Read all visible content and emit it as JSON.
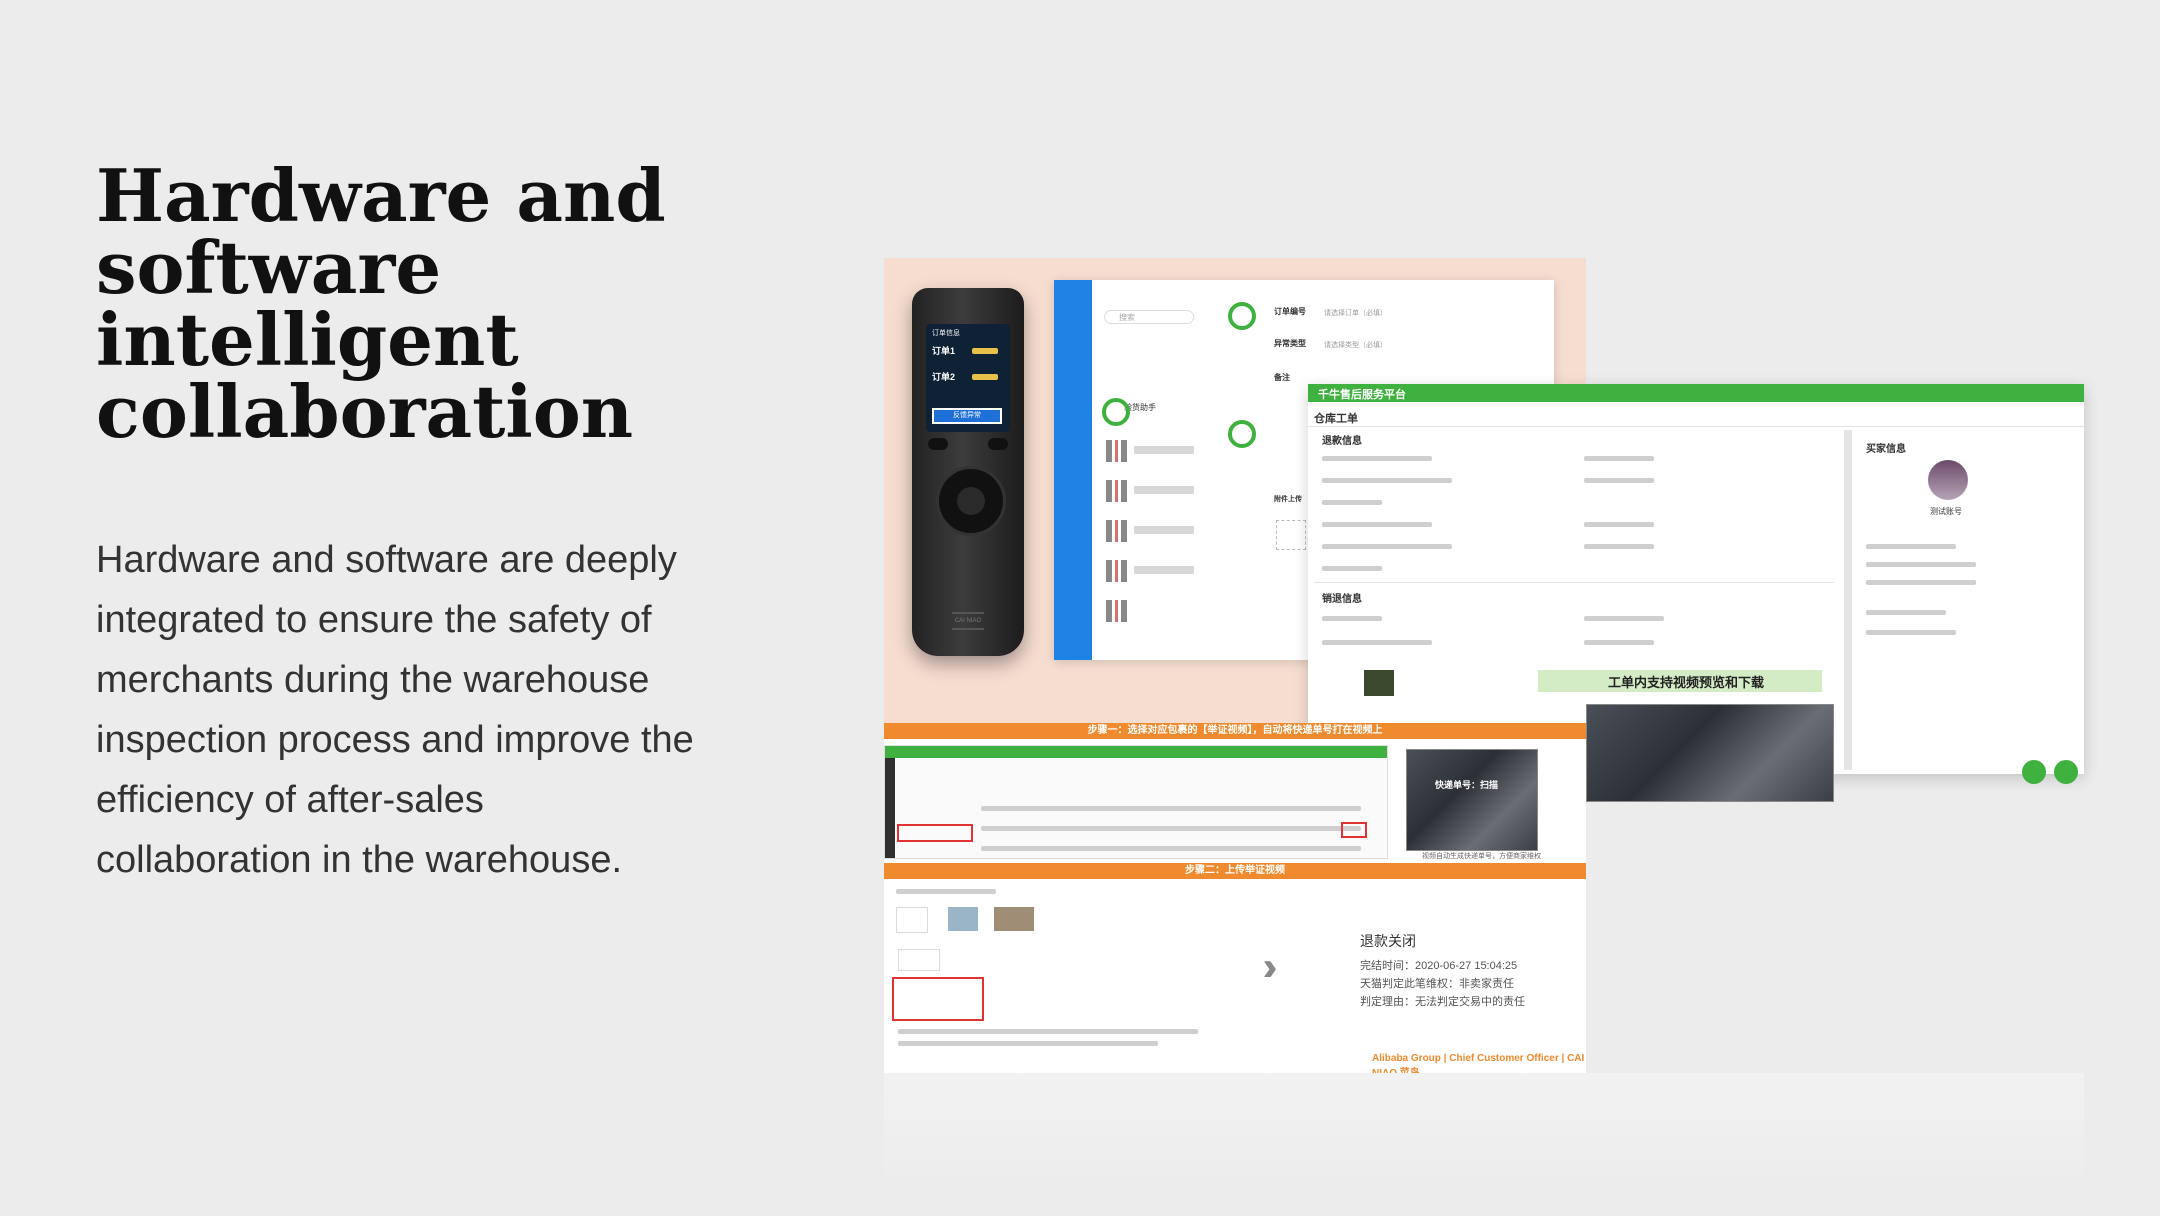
{
  "heading": "Hardware and software intelligent collaboration",
  "body": "Hardware and software are deeply integrated to ensure the safety of merchants during the warehouse inspection process and improve the efficiency of after-sales collaboration in the warehouse.",
  "collage": {
    "device": {
      "screen_header": "订单信息",
      "order1": "订单1",
      "order2": "订单2",
      "button": "反馈异常",
      "logo": "CAI NIAO"
    },
    "app_window": {
      "search_placeholder": "搜索",
      "field_order": "订单编号",
      "field_order_hint": "请选择订单（必填）",
      "field_exception": "异常类型",
      "field_exception_hint": "请选择类型（必填）",
      "field_note": "备注",
      "field_attach": "附件上传",
      "contact_name": "验货助手"
    },
    "service_window": {
      "platform": "千牛售后服务平台",
      "tab": "仓库工单",
      "section_refund": "退款信息",
      "section_warehouse": "销退信息",
      "section_buyer": "买家信息",
      "buyer_name": "测试账号",
      "video_caption": "工单内支持视频预览和下载",
      "video_overlay": "快递单号：扫描",
      "video_note": "视频自动生成快递单号，方便商家维权"
    },
    "steps": {
      "step1": "步骤一：选择对应包裹的【举证视频】，自动将快递单号打在视频上",
      "step2": "步骤二：上传举证视频",
      "refund_status": "退款关闭",
      "refund_time": "完结时间：2020-06-27 15:04:25",
      "refund_verdict": "天猫判定此笔维权：非卖家责任",
      "refund_reason": "判定理由：无法判定交易中的责任",
      "brand": "Alibaba Group | Chief Customer Officer | CAI NIAO 菜鸟"
    }
  }
}
